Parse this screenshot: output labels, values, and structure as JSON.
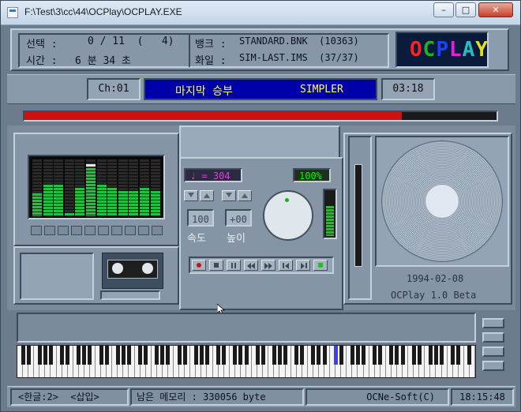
{
  "window": {
    "title": "F:\\Test\\3\\cc\\44\\OCPlay\\OCPLAY.EXE",
    "minimize_label": "–",
    "maximize_label": "□",
    "close_label": "✕"
  },
  "info": {
    "select_label": "선택 :",
    "select_value": "0 / 11  (   4)",
    "time_label": "시간 :",
    "time_value": "6 분 34 초",
    "bank_label": "뱅크 :",
    "bank_value": "STANDARD.BNK  (10363)",
    "file_label": "화일 :",
    "file_value": "SIM-LAST.IMS  (37/37)"
  },
  "logo": {
    "text": "OCPLAY",
    "colors": [
      "#ff2020",
      "#20b020",
      "#2040ff",
      "#e020e0",
      "#20c0c0",
      "#e0e020"
    ]
  },
  "track": {
    "channel": "Ch:01",
    "song_title": "마지막 승부",
    "composer": "SIMPLER",
    "elapsed": "03:18",
    "progress": 0.8
  },
  "controls": {
    "tempo_display": "♩ = 304",
    "volume_display": "100%",
    "speed_value": "100",
    "pitch_value": "+00",
    "speed_label": "속도",
    "pitch_label": "높이"
  },
  "speaker": {
    "date": "1994-02-08",
    "version": "OCPlay 1.0 Beta"
  },
  "statusbar": {
    "ime": "<한글:2>",
    "mode": "<삽입>",
    "memory": "남은 메모리 : 330056 byte",
    "company": "OCNe-Soft(C)",
    "clock": "18:15:48"
  },
  "equalizer": {
    "levels": [
      0.4,
      0.55,
      0.55,
      0.05,
      0.5,
      0.85,
      0.55,
      0.5,
      0.45,
      0.45,
      0.5,
      0.45
    ]
  },
  "colors": {
    "accent_blue": "#0000a8",
    "lcd_green": "#00ff00",
    "lcd_magenta": "#e040e0",
    "progress_red": "#d01010"
  },
  "icons": {
    "app": "ocplay-app-icon",
    "cursor": "mouse-pointer-icon",
    "mascot": "superman-sprite-icon"
  }
}
